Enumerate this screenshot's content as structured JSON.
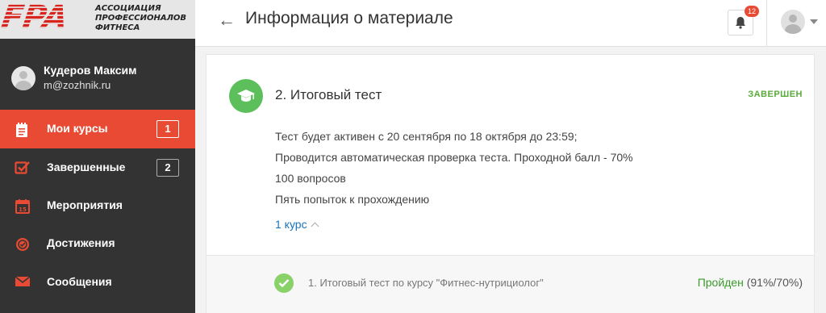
{
  "logo": {
    "mark": "FPA",
    "lines": [
      "АССОЦИАЦИЯ",
      "ПРОФЕССИОНАЛОВ",
      "ФИТНЕСА"
    ]
  },
  "user": {
    "name": "Кудеров Максим",
    "email": "m@zozhnik.ru"
  },
  "sidebar": {
    "items": [
      {
        "label": "Мои курсы",
        "badge": "1",
        "icon": "notepad-icon",
        "active": true
      },
      {
        "label": "Завершенные",
        "badge": "2",
        "icon": "checkbox-icon",
        "active": false
      },
      {
        "label": "Мероприятия",
        "badge": "",
        "icon": "calendar-icon",
        "active": false
      },
      {
        "label": "Достижения",
        "badge": "",
        "icon": "medal-icon",
        "active": false
      },
      {
        "label": "Сообщения",
        "badge": "",
        "icon": "envelope-icon",
        "active": false
      }
    ]
  },
  "header": {
    "title": "Информация о материале",
    "notifications_count": "12"
  },
  "material": {
    "title": "2. Итоговый тест",
    "status": "ЗАВЕРШЕН",
    "description": [
      "Тест будет активен с 20 сентября по 18 октября до 23:59;",
      "Проводится автоматическая проверка теста. Проходной балл - 70%",
      "100 вопросов",
      "Пять попыток к прохождению"
    ],
    "courses_link": "1 курс",
    "course": {
      "name": "1. Итоговый тест по курсу \"Фитнес-нутрициолог\"",
      "result_status": "Пройден",
      "result_score": "(91%/70%)"
    }
  },
  "colors": {
    "accent": "#e84a33",
    "sidebar_bg": "#333333",
    "success": "#5aaa3a",
    "link": "#1a73b8"
  }
}
